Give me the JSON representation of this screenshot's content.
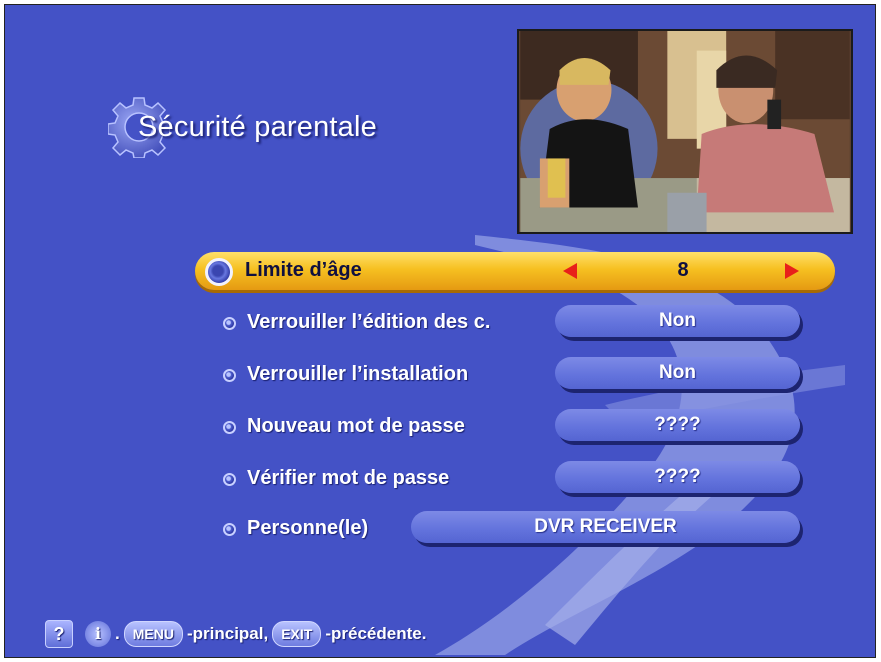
{
  "screen": {
    "title": "Sécurité parentale",
    "title_icon": "gear-icon"
  },
  "menu": {
    "items": [
      {
        "label": "Limite d’âge",
        "value": "8",
        "selected": true
      },
      {
        "label": "Verrouiller l’édition des c.",
        "value": "Non"
      },
      {
        "label": "Verrouiller l’installation",
        "value": "Non"
      },
      {
        "label": "Nouveau mot de passe",
        "value": "????"
      },
      {
        "label": "Vérifier mot de passe",
        "value": "????"
      },
      {
        "label": "Personne(le)",
        "value": "DVR RECEIVER"
      }
    ]
  },
  "help": {
    "separator1": ".",
    "menu_key": "MENU",
    "menu_text": "-principal,",
    "exit_key": "EXIT",
    "exit_text": "-précédente.",
    "question_icon": "?",
    "info_icon": "i"
  },
  "colors": {
    "background": "#4452c6",
    "highlight": "#f6c021",
    "pill": "#6272dc",
    "arrow": "#e8201a"
  }
}
